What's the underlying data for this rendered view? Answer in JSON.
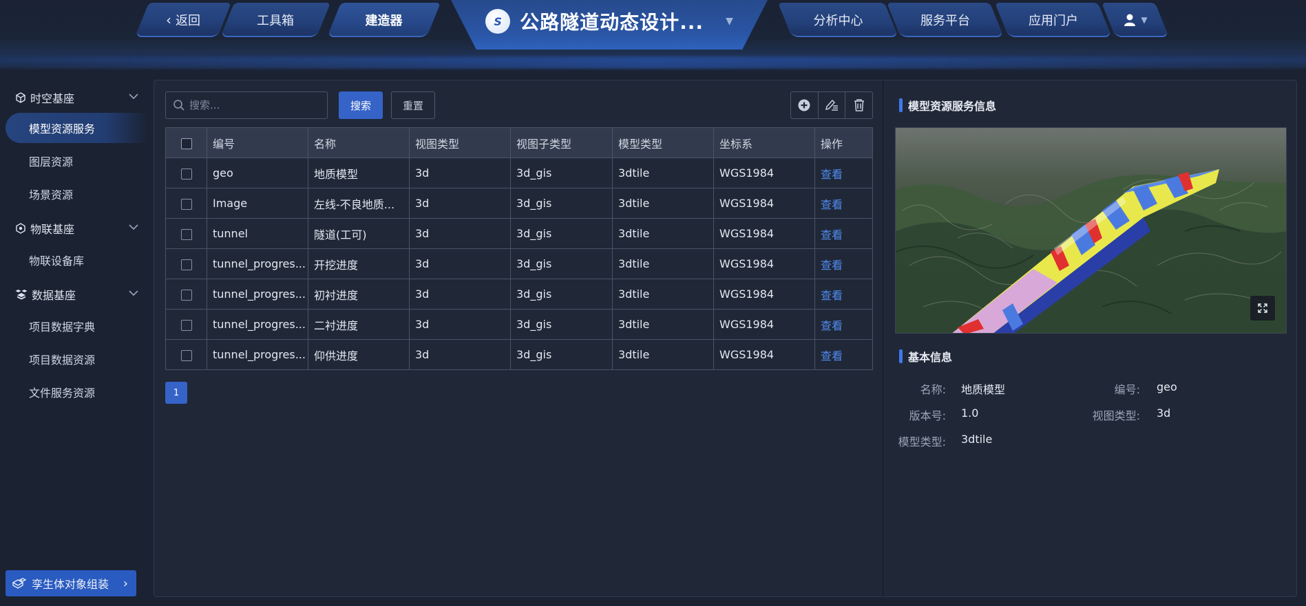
{
  "nav": {
    "back": "返回",
    "toolbox": "工具箱",
    "builder": "建造器",
    "title": "公路隧道动态设计...",
    "analysis": "分析中心",
    "service": "服务平台",
    "portal": "应用门户"
  },
  "sidebar": {
    "groups": [
      {
        "label": "时空基座",
        "icon": "cube-icon"
      },
      {
        "label": "物联基座",
        "icon": "network-icon"
      },
      {
        "label": "数据基座",
        "icon": "boxes-icon"
      }
    ],
    "items": [
      "模型资源服务",
      "图层资源",
      "场景资源",
      "物联设备库",
      "项目数据字典",
      "项目数据资源",
      "文件服务资源"
    ],
    "active_item": "模型资源服务",
    "assemble_button": "孪生体对象组装"
  },
  "search": {
    "placeholder": "搜索...",
    "search_button": "搜索",
    "reset_button": "重置"
  },
  "table": {
    "headers": [
      "编号",
      "名称",
      "视图类型",
      "视图子类型",
      "模型类型",
      "坐标系",
      "操作"
    ],
    "rows": [
      [
        "geo",
        "地质模型",
        "3d",
        "3d_gis",
        "3dtile",
        "WGS1984",
        "查看"
      ],
      [
        "Image",
        "左线-不良地质...",
        "3d",
        "3d_gis",
        "3dtile",
        "WGS1984",
        "查看"
      ],
      [
        "tunnel",
        "隧道(工可)",
        "3d",
        "3d_gis",
        "3dtile",
        "WGS1984",
        "查看"
      ],
      [
        "tunnel_progres...",
        "开挖进度",
        "3d",
        "3d_gis",
        "3dtile",
        "WGS1984",
        "查看"
      ],
      [
        "tunnel_progres...",
        "初衬进度",
        "3d",
        "3d_gis",
        "3dtile",
        "WGS1984",
        "查看"
      ],
      [
        "tunnel_progres...",
        "二衬进度",
        "3d",
        "3d_gis",
        "3dtile",
        "WGS1984",
        "查看"
      ],
      [
        "tunnel_progres...",
        "仰供进度",
        "3d",
        "3d_gis",
        "3dtile",
        "WGS1984",
        "查看"
      ]
    ]
  },
  "pagination": {
    "current": "1"
  },
  "info": {
    "service_title": "模型资源服务信息",
    "basic_title": "基本信息",
    "name_label": "名称:",
    "name_value": "地质模型",
    "id_label": "编号:",
    "id_value": "geo",
    "version_label": "版本号:",
    "version_value": "1.0",
    "view_type_label": "视图类型:",
    "view_type_value": "3d",
    "model_type_label": "模型类型:",
    "model_type_value": "3dtile"
  },
  "colors": {
    "accent": "#3563c8",
    "link": "#4f8bf0",
    "background": "#1b2232",
    "panel": "#202838"
  }
}
